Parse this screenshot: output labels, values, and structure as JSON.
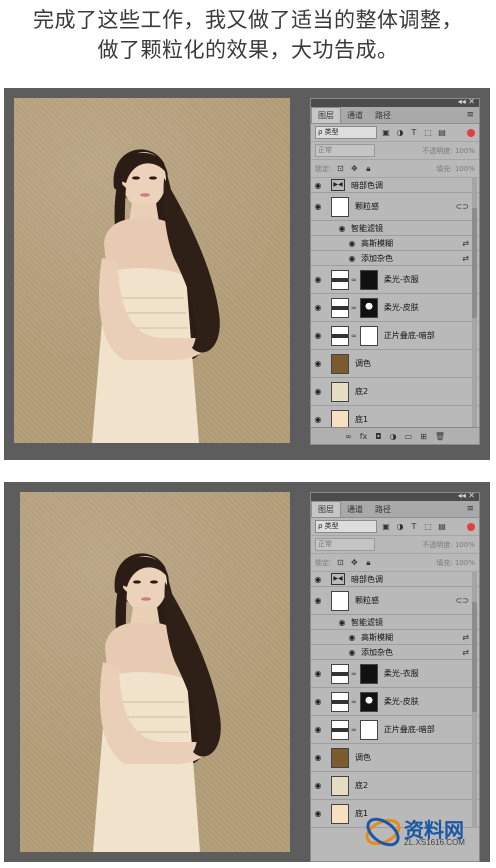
{
  "caption": {
    "line1": "完成了这些工作，我又做了适当的整体调整，",
    "line2": "做了颗粒化的效果，大功告成。"
  },
  "panel": {
    "tabs": [
      "图层",
      "通道",
      "路径"
    ],
    "filter_label": "ρ 类型",
    "blend_mode": "正常",
    "opacity_label": "不透明度: 100%",
    "lock_label": "锁定:",
    "fill_label": "填充: 100%",
    "layers": [
      {
        "name": "暗部色调",
        "type": "adjustment"
      },
      {
        "name": "颗粒感",
        "type": "smart"
      },
      {
        "name": "智能滤镜",
        "type": "sub"
      },
      {
        "name": "高斯模糊",
        "type": "sub2"
      },
      {
        "name": "添加杂色",
        "type": "sub2"
      },
      {
        "name": "柔光-衣服",
        "type": "masked"
      },
      {
        "name": "柔光-皮肤",
        "type": "masked"
      },
      {
        "name": "正片叠底-暗部",
        "type": "masked"
      },
      {
        "name": "调色",
        "type": "fill"
      },
      {
        "name": "底2",
        "type": "fill"
      },
      {
        "name": "底1",
        "type": "fill"
      }
    ],
    "bottom_icons": [
      "link-icon",
      "fx-icon",
      "mask-icon",
      "adjustment-icon",
      "folder-icon",
      "new-layer-icon",
      "trash-icon"
    ]
  },
  "watermark": {
    "brand": "资料网",
    "url": "ZL.XS1616.COM"
  },
  "colors": {
    "canvas_bg": "#b59f7a",
    "panel_bg": "#b9b9b9",
    "frame_bg": "#5d5d5d"
  }
}
